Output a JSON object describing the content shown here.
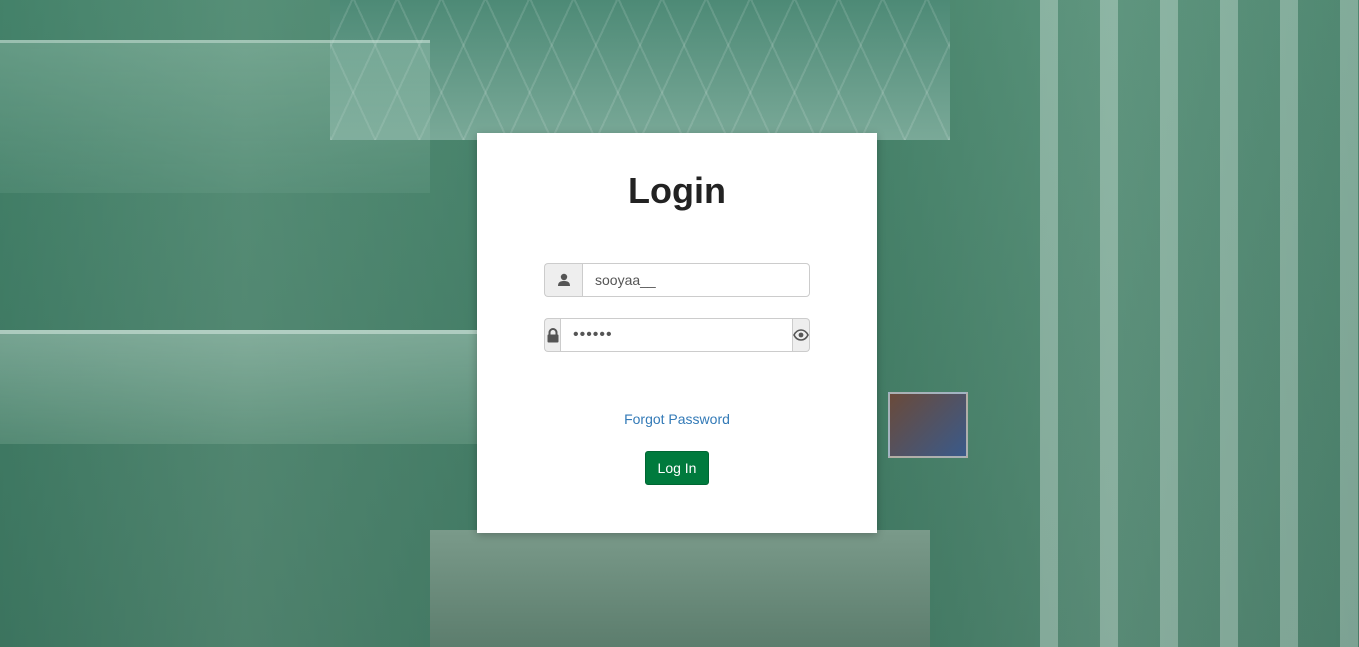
{
  "login": {
    "title": "Login",
    "username_value": "sooyaa__",
    "password_value": "••••••",
    "forgot_password": "Forgot Password",
    "submit_label": "Log In"
  },
  "icons": {
    "username": "user-icon",
    "password": "lock-icon",
    "toggle": "eye-icon"
  },
  "colors": {
    "background_tint": "#2d785a",
    "button": "#007a3d",
    "link": "#337ab7",
    "title": "#222222"
  }
}
